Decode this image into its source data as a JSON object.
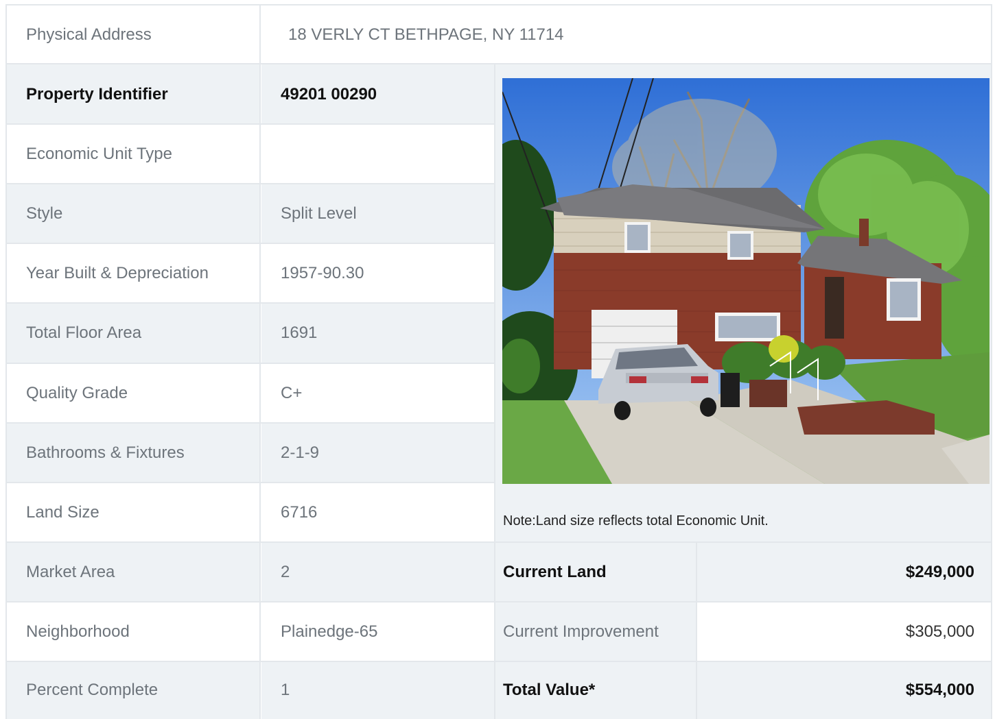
{
  "address": {
    "label": "Physical Address",
    "value": "18  VERLY CT  BETHPAGE, NY  11714"
  },
  "rows": [
    {
      "label": "Property Identifier",
      "value": "49201  00290"
    },
    {
      "label": "Economic Unit Type",
      "value": ""
    },
    {
      "label": "Style",
      "value": "Split Level"
    },
    {
      "label": "Year Built & Depreciation",
      "value": "1957-90.30"
    },
    {
      "label": "Total Floor Area",
      "value": "1691"
    },
    {
      "label": "Quality Grade",
      "value": "C+"
    },
    {
      "label": "Bathrooms & Fixtures",
      "value": "2-1-9"
    },
    {
      "label": "Land Size",
      "value": "6716"
    },
    {
      "label": "Market Area",
      "value": "2"
    },
    {
      "label": "Neighborhood",
      "value": "Plainedge-65"
    },
    {
      "label": "Percent Complete",
      "value": "1"
    }
  ],
  "note": "Note:Land size reflects total Economic Unit.",
  "values": [
    {
      "label": "Current Land",
      "value": "$249,000"
    },
    {
      "label": "Current Improvement",
      "value": "$305,000"
    },
    {
      "label": "Total Value*",
      "value": "$554,000"
    }
  ],
  "colors": {
    "row_grey": "#eef2f5",
    "border": "#e3e7eb",
    "label_text": "#6d747b",
    "bold_text": "#111111"
  }
}
